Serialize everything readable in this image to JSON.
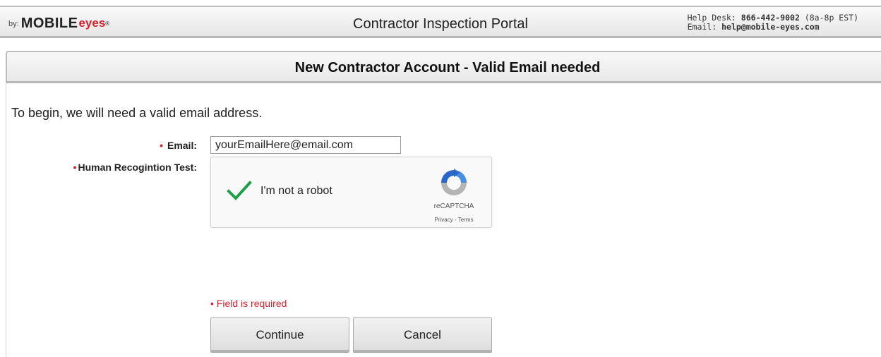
{
  "header": {
    "brand_by": "by:",
    "brand_mobile": "MOBILE",
    "brand_eyes": "eyes",
    "brand_reg": "®",
    "title": "Contractor Inspection Portal",
    "helpdesk_label": "Help Desk:",
    "helpdesk_phone": "866-442-9002",
    "helpdesk_hours": "(8a-8p EST)",
    "email_label": "Email:",
    "email_value": "help@mobile-eyes.com"
  },
  "section": {
    "title": "New Contractor Account - Valid Email needed"
  },
  "form": {
    "intro": "To begin, we will need a valid email address.",
    "required_marker": "•",
    "email_label": "Email:",
    "email_value": "yourEmailHere@email.com",
    "captcha_label": "Human Recogintion Test:",
    "captcha_text": "I'm not a robot",
    "captcha_brand": "reCAPTCHA",
    "captcha_links": "Privacy - Terms",
    "required_note": "• Field is required"
  },
  "buttons": {
    "continue": "Continue",
    "cancel": "Cancel"
  },
  "colors": {
    "accent_red": "#d0222a",
    "check_green": "#1d9e48"
  }
}
